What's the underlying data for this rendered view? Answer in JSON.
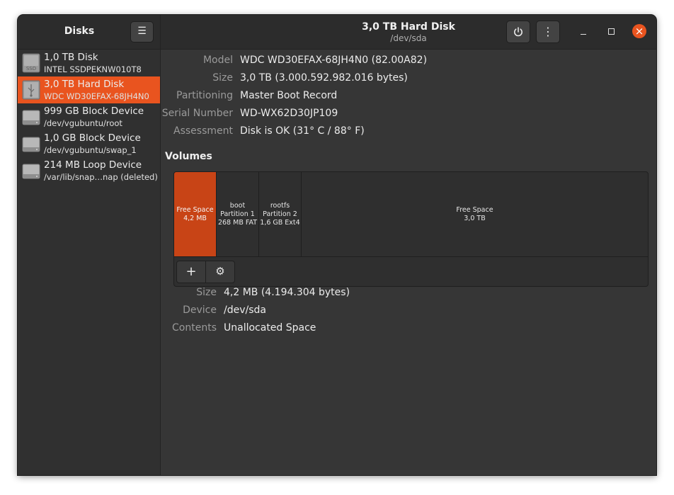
{
  "sidebar": {
    "title": "Disks",
    "menu_icon": "hamburger-menu-icon",
    "devices": [
      {
        "name": "1,0 TB Disk",
        "detail": "INTEL SSDPEKNW010T8",
        "icon": "ssd-drive-icon",
        "icon_label": "SSD",
        "selected": false
      },
      {
        "name": "3,0 TB Hard Disk",
        "detail": "WDC WD30EFAX-68JH4N0",
        "icon": "usb-drive-icon",
        "selected": true
      },
      {
        "name": "999 GB Block Device",
        "detail": "/dev/vgubuntu/root",
        "icon": "block-device-icon",
        "selected": false
      },
      {
        "name": "1,0 GB Block Device",
        "detail": "/dev/vgubuntu/swap_1",
        "icon": "block-device-icon",
        "selected": false
      },
      {
        "name": "214 MB Loop Device",
        "detail": "/var/lib/snap…nap (deleted)",
        "icon": "block-device-icon",
        "selected": false
      }
    ]
  },
  "header": {
    "title": "3,0 TB Hard Disk",
    "subtitle": "/dev/sda"
  },
  "disk_properties": [
    {
      "label": "Model",
      "value": "WDC WD30EFAX-68JH4N0 (82.00A82)"
    },
    {
      "label": "Size",
      "value": "3,0 TB (3.000.592.982.016 bytes)"
    },
    {
      "label": "Partitioning",
      "value": "Master Boot Record"
    },
    {
      "label": "Serial Number",
      "value": "WD-WX62D30JP109"
    },
    {
      "label": "Assessment",
      "value": "Disk is OK (31° C / 88° F)"
    }
  ],
  "volumes": {
    "title": "Volumes",
    "segments": [
      {
        "lines": [
          "Free Space",
          "4,2 MB"
        ],
        "selected": true
      },
      {
        "lines": [
          "boot",
          "Partition 1",
          "268 MB FAT"
        ],
        "selected": false
      },
      {
        "lines": [
          "rootfs",
          "Partition 2",
          "1,6 GB Ext4"
        ],
        "selected": false
      },
      {
        "lines": [
          "Free Space",
          "3,0 TB"
        ],
        "selected": false
      }
    ],
    "toolbar": {
      "add_icon": "plus-icon",
      "settings_icon": "gears-icon"
    }
  },
  "volume_properties": [
    {
      "label": "Size",
      "value": "4,2 MB (4.194.304 bytes)"
    },
    {
      "label": "Device",
      "value": "/dev/sda"
    },
    {
      "label": "Contents",
      "value": "Unallocated Space"
    }
  ],
  "colors": {
    "accent": "#e9541f",
    "selected_volume": "#c84416",
    "background": "#363636"
  }
}
